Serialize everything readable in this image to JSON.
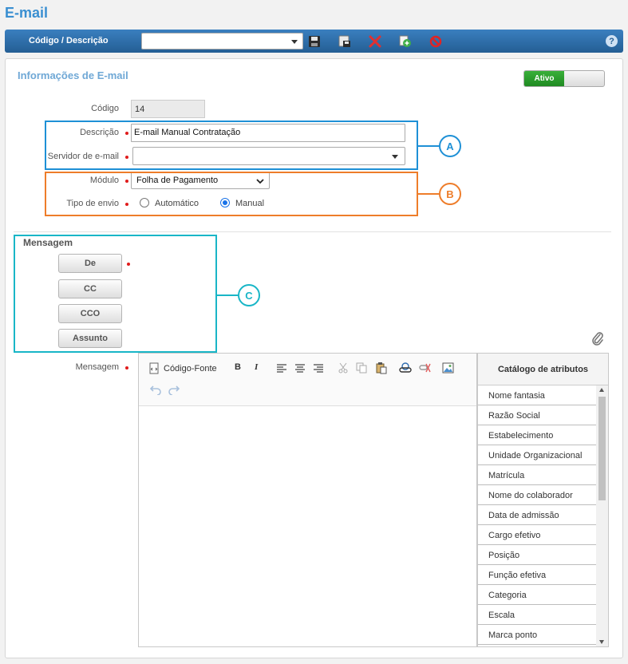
{
  "page": {
    "title": "E-mail"
  },
  "toolbar": {
    "label": "Código / Descrição",
    "select_value": "",
    "help": "?"
  },
  "section": {
    "title": "Informações de E-mail"
  },
  "status_toggle": {
    "label": "Ativo",
    "active": true
  },
  "fields": {
    "codigo": {
      "label": "Código",
      "value": "14"
    },
    "descricao": {
      "label": "Descrição",
      "value": "E-mail Manual Contratação"
    },
    "servidor": {
      "label": "Servidor de e-mail",
      "value": ""
    },
    "modulo": {
      "label": "Módulo",
      "value": "Folha de Pagamento"
    },
    "tipo_envio": {
      "label": "Tipo de envio",
      "options": [
        "Automático",
        "Manual"
      ],
      "selected": "Manual"
    }
  },
  "annotations": {
    "a": "A",
    "b": "B",
    "c": "C"
  },
  "colors": {
    "a": "#1e90d6",
    "b": "#ee7d2a",
    "c": "#19b6c7"
  },
  "mensagem": {
    "title": "Mensagem",
    "buttons": {
      "de": "De",
      "cc": "CC",
      "cco": "CCO",
      "assunto": "Assunto"
    },
    "editor_label": "Mensagem"
  },
  "editor": {
    "source_label": "Código-Fonte",
    "bold": "B",
    "italic": "I"
  },
  "catalog": {
    "title": "Catálogo de atributos",
    "items": [
      "Nome fantasia",
      "Razão Social",
      "Estabelecimento",
      "Unidade Organizacional",
      "Matrícula",
      "Nome do colaborador",
      "Data de admissão",
      "Cargo efetivo",
      "Posição",
      "Função efetiva",
      "Categoria",
      "Escala",
      "Marca ponto"
    ]
  }
}
